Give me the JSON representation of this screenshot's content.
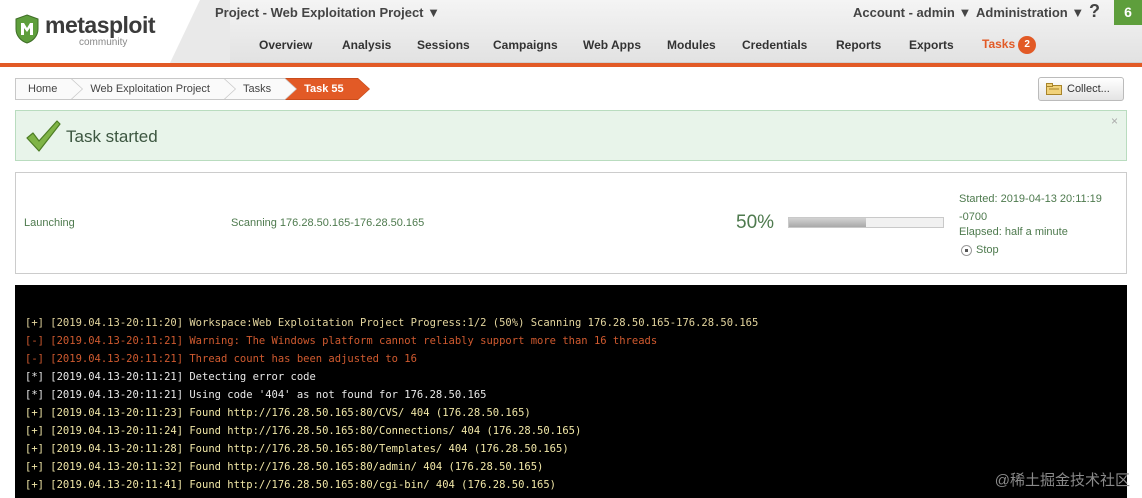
{
  "header": {
    "logo_text": "metasploit",
    "logo_subtext": "community",
    "project_menu": "Project - Web Exploitation Project ▼",
    "account_menu": "Account - admin ▼",
    "admin_menu": "Administration ▼",
    "help": "?",
    "notifications": "6"
  },
  "nav": [
    {
      "label": "Overview"
    },
    {
      "label": "Analysis"
    },
    {
      "label": "Sessions"
    },
    {
      "label": "Campaigns"
    },
    {
      "label": "Web Apps"
    },
    {
      "label": "Modules"
    },
    {
      "label": "Credentials"
    },
    {
      "label": "Reports"
    },
    {
      "label": "Exports"
    },
    {
      "label": "Tasks",
      "badge": "2"
    }
  ],
  "breadcrumb": [
    {
      "label": "Home"
    },
    {
      "label": "Web Exploitation Project"
    },
    {
      "label": "Tasks"
    },
    {
      "label": "Task 55"
    }
  ],
  "collect_button": "Collect...",
  "banner": {
    "text": "Task started",
    "close": "×"
  },
  "task": {
    "phase": "Launching",
    "description": "Scanning 176.28.50.165-176.28.50.165",
    "percent_text": "50%",
    "progress": 0.5,
    "started": "Started: 2019-04-13 20:11:19 -0700",
    "elapsed": "Elapsed: half a minute",
    "stop": "Stop"
  },
  "console": [
    {
      "text": "[+] [2019.04.13-20:11:20] Workspace:Web Exploitation Project Progress:1/2 (50%) Scanning 176.28.50.165-176.28.50.165",
      "kind": "progress-line"
    },
    {
      "text": "[-] [2019.04.13-20:11:21] Warning: The Windows platform cannot reliably support more than 16 threads",
      "kind": "warn"
    },
    {
      "text": "[-] [2019.04.13-20:11:21] Thread count has been adjusted to 16",
      "kind": "warn"
    },
    {
      "text": "[*] [2019.04.13-20:11:21] Detecting error code",
      "kind": "info"
    },
    {
      "text": "[*] [2019.04.13-20:11:21] Using code '404' as not found for 176.28.50.165",
      "kind": "info"
    },
    {
      "text": "[+] [2019.04.13-20:11:23] Found http://176.28.50.165:80/CVS/ 404 (176.28.50.165)",
      "kind": "good"
    },
    {
      "text": "[+] [2019.04.13-20:11:24] Found http://176.28.50.165:80/Connections/ 404 (176.28.50.165)",
      "kind": "good"
    },
    {
      "text": "[+] [2019.04.13-20:11:28] Found http://176.28.50.165:80/Templates/ 404 (176.28.50.165)",
      "kind": "good"
    },
    {
      "text": "[+] [2019.04.13-20:11:32] Found http://176.28.50.165:80/admin/ 404 (176.28.50.165)",
      "kind": "good"
    },
    {
      "text": "[+] [2019.04.13-20:11:41] Found http://176.28.50.165:80/cgi-bin/ 404 (176.28.50.165)",
      "kind": "good"
    }
  ],
  "watermark": "@稀土掘金技术社区",
  "colors": {
    "brand": "#e25a26",
    "success": "#4e7a4e",
    "console_bg": "#000000"
  },
  "icons": {
    "logo": "metasploit-shield-icon",
    "collect": "folder-icon",
    "banner": "checkmark-icon",
    "stop": "stop-icon"
  }
}
